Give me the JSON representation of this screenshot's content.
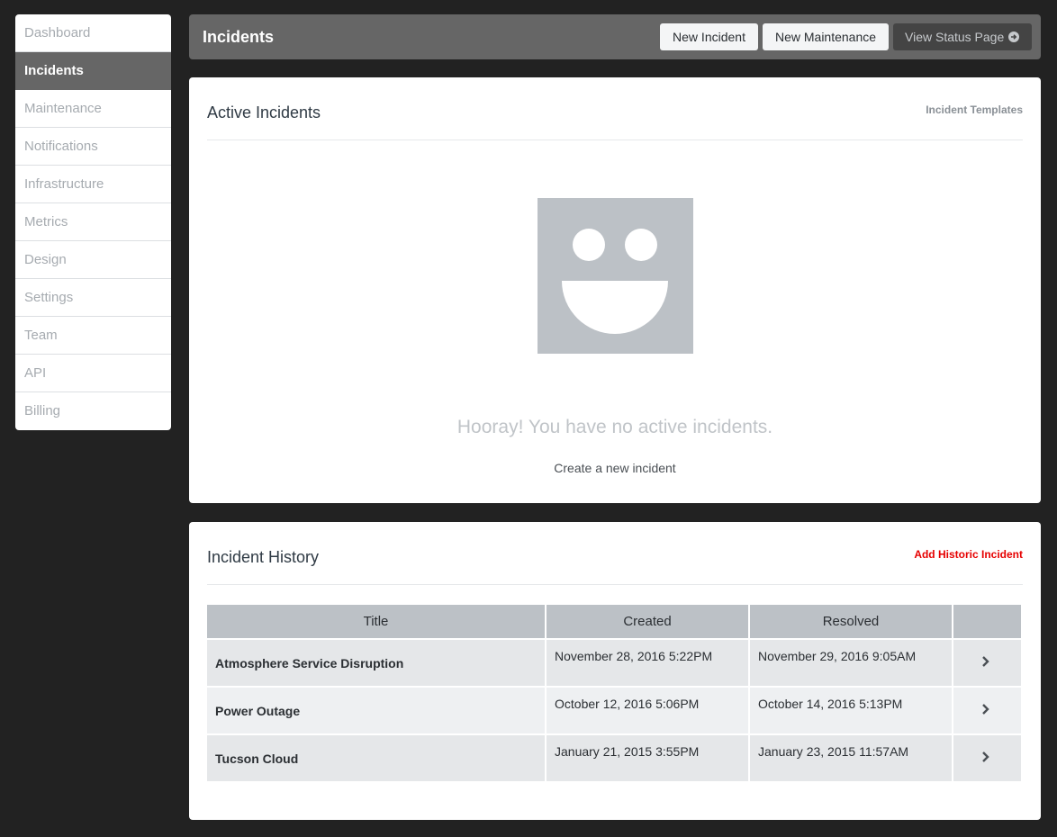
{
  "sidebar": {
    "items": [
      {
        "label": "Dashboard"
      },
      {
        "label": "Incidents",
        "active": true
      },
      {
        "label": "Maintenance"
      },
      {
        "label": "Notifications"
      },
      {
        "label": "Infrastructure"
      },
      {
        "label": "Metrics"
      },
      {
        "label": "Design"
      },
      {
        "label": "Settings"
      },
      {
        "label": "Team"
      },
      {
        "label": "API"
      },
      {
        "label": "Billing"
      }
    ]
  },
  "header": {
    "title": "Incidents",
    "new_incident_label": "New Incident",
    "new_maintenance_label": "New Maintenance",
    "view_status_label": "View Status Page"
  },
  "active_panel": {
    "title": "Active Incidents",
    "templates_link": "Incident Templates",
    "empty_message": "Hooray! You have no active incidents.",
    "create_link": "Create a new incident"
  },
  "history_panel": {
    "title": "Incident History",
    "add_link": "Add Historic Incident",
    "columns": [
      "Title",
      "Created",
      "Resolved",
      ""
    ],
    "rows": [
      {
        "title": "Atmosphere Service Disruption",
        "created": "November 28, 2016 5:22PM",
        "resolved": "November 29, 2016 9:05AM"
      },
      {
        "title": "Power Outage",
        "created": "October 12, 2016 5:06PM",
        "resolved": "October 14, 2016 5:13PM"
      },
      {
        "title": "Tucson Cloud",
        "created": "January 21, 2015 3:55PM",
        "resolved": "January 23, 2015 11:57AM"
      }
    ]
  },
  "icons": {
    "empty_state": "smiley-face-icon",
    "row_action": "chevron-right-icon",
    "view_status": "circle-arrow-right-icon"
  },
  "colors": {
    "background": "#222222",
    "header": "#666666",
    "accent_red": "#e60000",
    "smiley": "#bcc1c6"
  }
}
